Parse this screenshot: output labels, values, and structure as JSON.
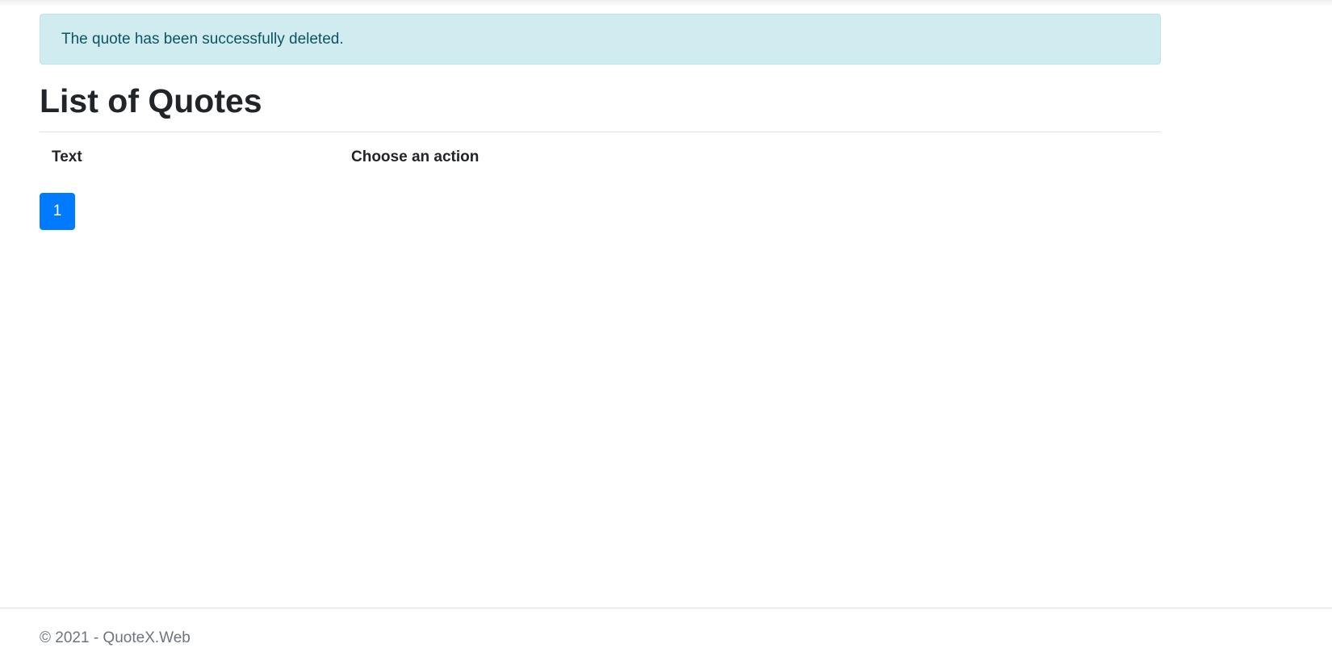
{
  "alert": {
    "message": "The quote has been successfully deleted."
  },
  "main": {
    "title": "List of Quotes",
    "table": {
      "columns": [
        "Text",
        "Choose an action"
      ],
      "rows": []
    },
    "pagination": {
      "pages": [
        "1"
      ],
      "active_page": "1"
    }
  },
  "footer": {
    "text": "© 2021 - QuoteX.Web"
  },
  "colors": {
    "alert_bg": "#d1ecf1",
    "alert_text": "#0c5460",
    "primary": "#007bff",
    "footer_text": "#6c757d"
  }
}
